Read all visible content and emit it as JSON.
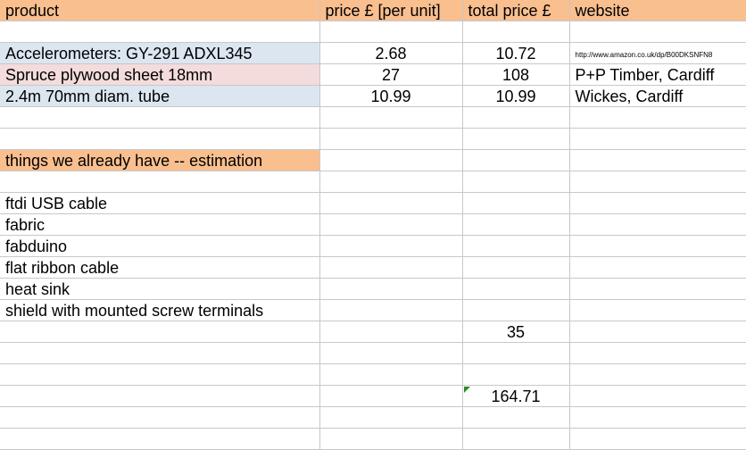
{
  "header": {
    "product": "product",
    "price_unit": "price £ [per unit]",
    "total_price": "total price £",
    "website": "website"
  },
  "items": [
    {
      "product": "Accelerometers: GY-291 ADXL345",
      "price": "2.68",
      "total": "10.72",
      "website": "http://www.amazon.co.uk/dp/B00DKSNFN8"
    },
    {
      "product": "Spruce plywood sheet 18mm",
      "price": "27",
      "total": "108",
      "website": "P+P Timber, Cardiff"
    },
    {
      "product": "2.4m 70mm diam. tube",
      "price": "10.99",
      "total": "10.99",
      "website": "Wickes, Cardiff"
    }
  ],
  "section_heading": "things we already have -- estimation",
  "have_items": [
    "ftdi USB cable",
    "fabric",
    "fabduino",
    "flat ribbon cable",
    "heat sink",
    "shield with mounted screw terminals"
  ],
  "estimate_total": "35",
  "grand_total": "164.71",
  "colors": {
    "header": "#f9bf8f",
    "row_blue": "#dce6f0",
    "row_pink": "#f3dcdb",
    "grid": "#c8c8c8"
  }
}
